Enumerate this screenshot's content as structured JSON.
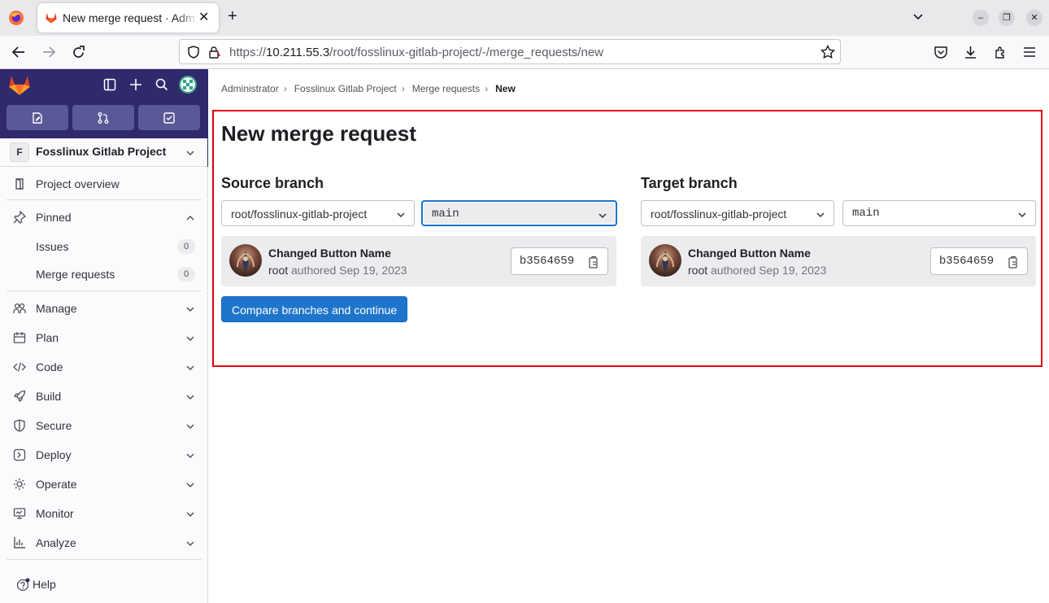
{
  "browser": {
    "tab_title": "New merge request · Administrator / Fosslinux Gitlab Project · GitLab",
    "tab_close": "✕",
    "new_tab": "+",
    "url_prefix": "https://",
    "url_host": "10.211.55.3",
    "url_path": "/root/fosslinux-gitlab-project/-/merge_requests/new",
    "window_min": "–",
    "window_max": "❐",
    "window_close": "✕"
  },
  "sidebar": {
    "project_initial": "F",
    "project_name": "Fosslinux Gitlab Project",
    "items": [
      {
        "label": "Project overview"
      },
      {
        "label": "Pinned"
      },
      {
        "label": "Issues",
        "count": "0"
      },
      {
        "label": "Merge requests",
        "count": "0"
      },
      {
        "label": "Manage"
      },
      {
        "label": "Plan"
      },
      {
        "label": "Code"
      },
      {
        "label": "Build"
      },
      {
        "label": "Secure"
      },
      {
        "label": "Deploy"
      },
      {
        "label": "Operate"
      },
      {
        "label": "Monitor"
      },
      {
        "label": "Analyze"
      }
    ],
    "help": "Help"
  },
  "breadcrumbs": [
    "Administrator",
    "Fosslinux Gitlab Project",
    "Merge requests",
    "New"
  ],
  "page_title": "New merge request",
  "source": {
    "heading": "Source branch",
    "project": "root/fosslinux-gitlab-project",
    "branch": "main",
    "commit_title": "Changed Button Name",
    "author": "root",
    "authored": "authored Sep 19, 2023",
    "sha": "b3564659"
  },
  "target": {
    "heading": "Target branch",
    "project": "root/fosslinux-gitlab-project",
    "branch": "main",
    "commit_title": "Changed Button Name",
    "author": "root",
    "authored": "authored Sep 19, 2023",
    "sha": "b3564659"
  },
  "submit_label": "Compare branches and continue",
  "colors": {
    "primary": "#1f75cb",
    "sidebar_top": "#2f2a6b",
    "highlight": "#e3000b"
  }
}
